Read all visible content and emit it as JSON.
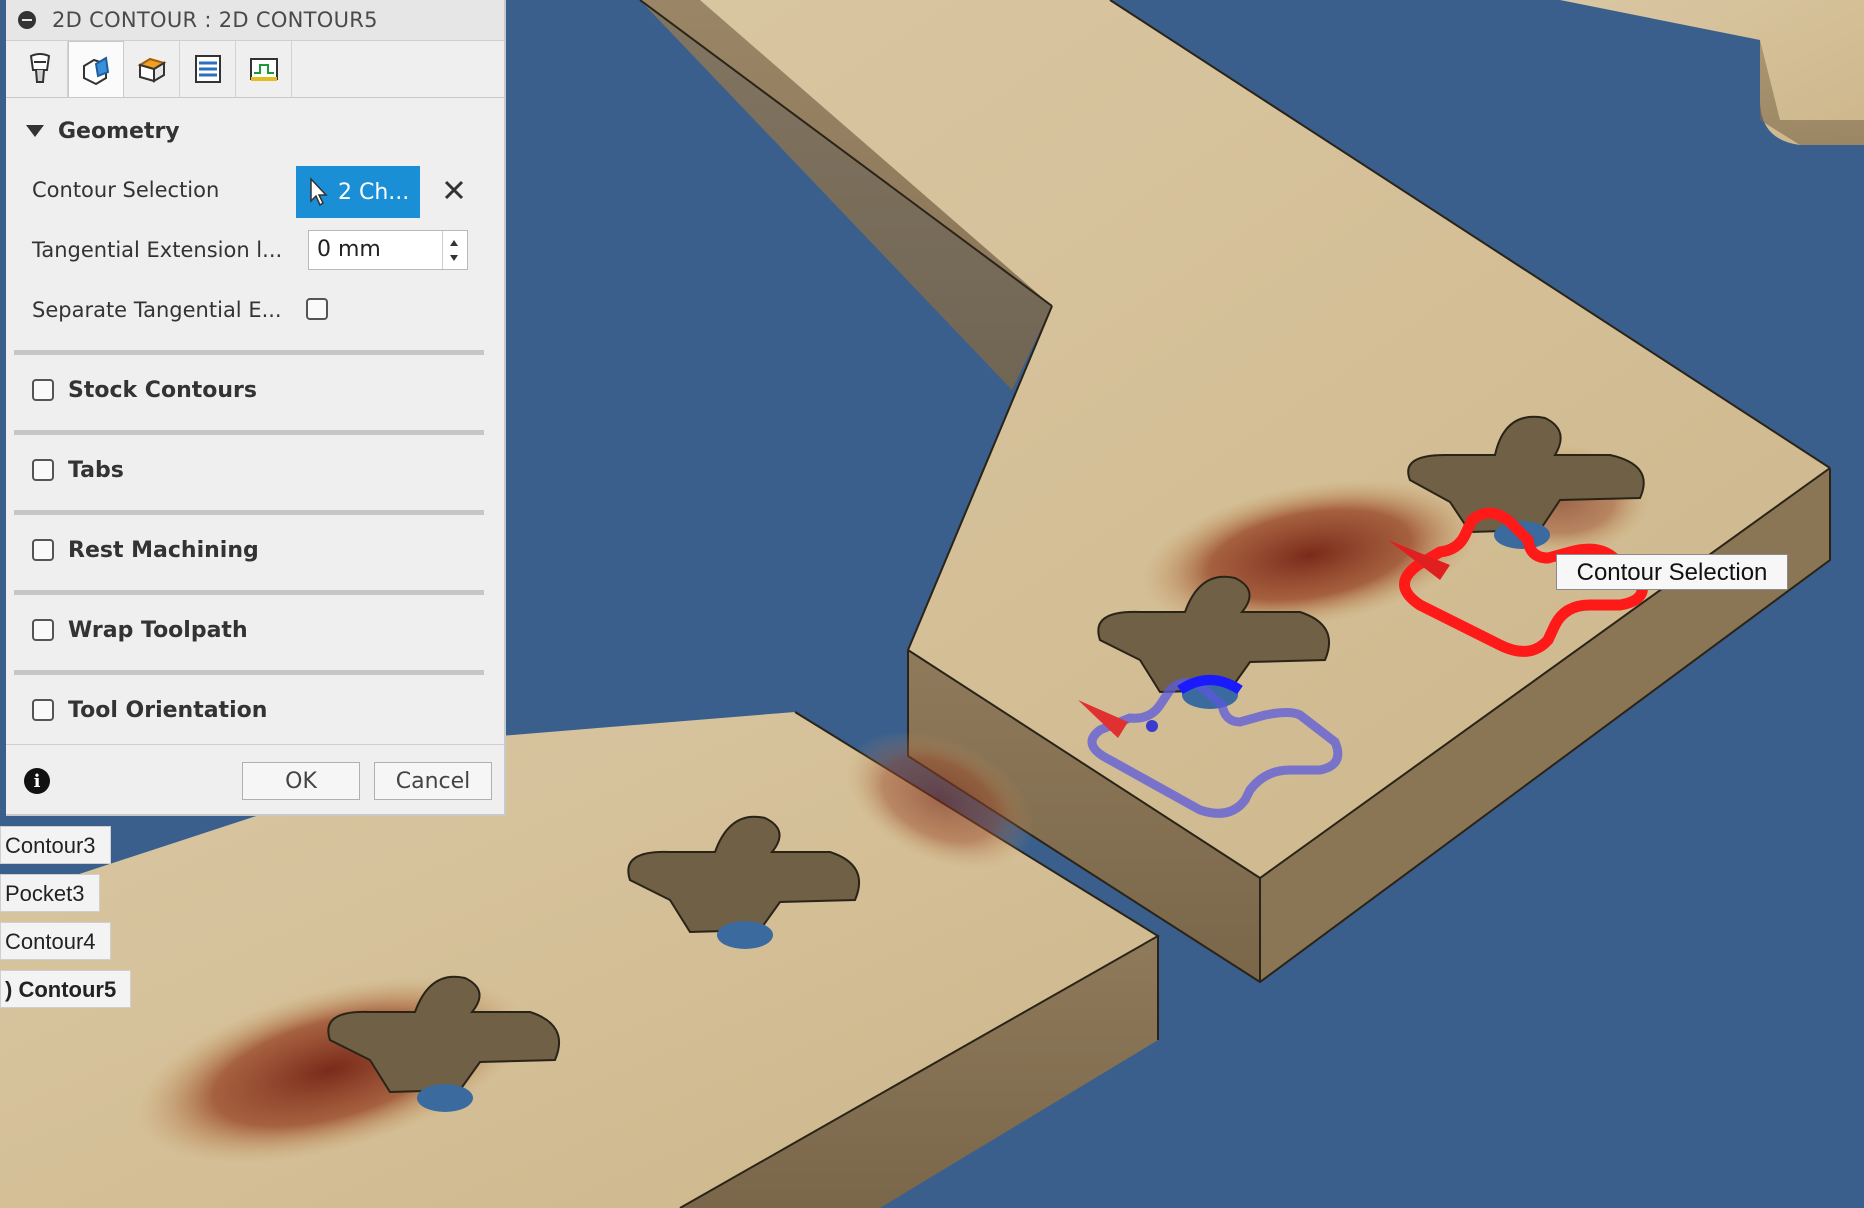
{
  "panel": {
    "title": "2D CONTOUR : 2D CONTOUR5",
    "tabs": [
      {
        "name": "tool-tab",
        "icon": "tool-icon"
      },
      {
        "name": "geometry-tab",
        "icon": "geometry-icon",
        "active": true
      },
      {
        "name": "heights-tab",
        "icon": "heights-icon"
      },
      {
        "name": "passes-tab",
        "icon": "passes-icon"
      },
      {
        "name": "linking-tab",
        "icon": "linking-icon"
      }
    ],
    "geometry": {
      "header": "Geometry",
      "contour_selection_label": "Contour Selection",
      "contour_selection_value": "2 Ch...",
      "tangential_extension_label": "Tangential Extension l...",
      "tangential_extension_value": "0 mm",
      "separate_tangential_label": "Separate Tangential E..."
    },
    "sections": [
      {
        "label": "Stock Contours",
        "checked": false
      },
      {
        "label": "Tabs",
        "checked": false
      },
      {
        "label": "Rest Machining",
        "checked": false
      },
      {
        "label": "Wrap Toolpath",
        "checked": false
      },
      {
        "label": "Tool Orientation",
        "checked": false
      }
    ],
    "ok_label": "OK",
    "cancel_label": "Cancel",
    "info_glyph": "i"
  },
  "browser_items": [
    "Contour3",
    "Pocket3",
    "Contour4",
    ") Contour5"
  ],
  "tooltip": "Contour Selection",
  "colors": {
    "background": "#3a5f8c",
    "accent": "#1a8fd6",
    "selected_contour": "#ff1a1a",
    "preview_contour": "#5a5adc"
  }
}
